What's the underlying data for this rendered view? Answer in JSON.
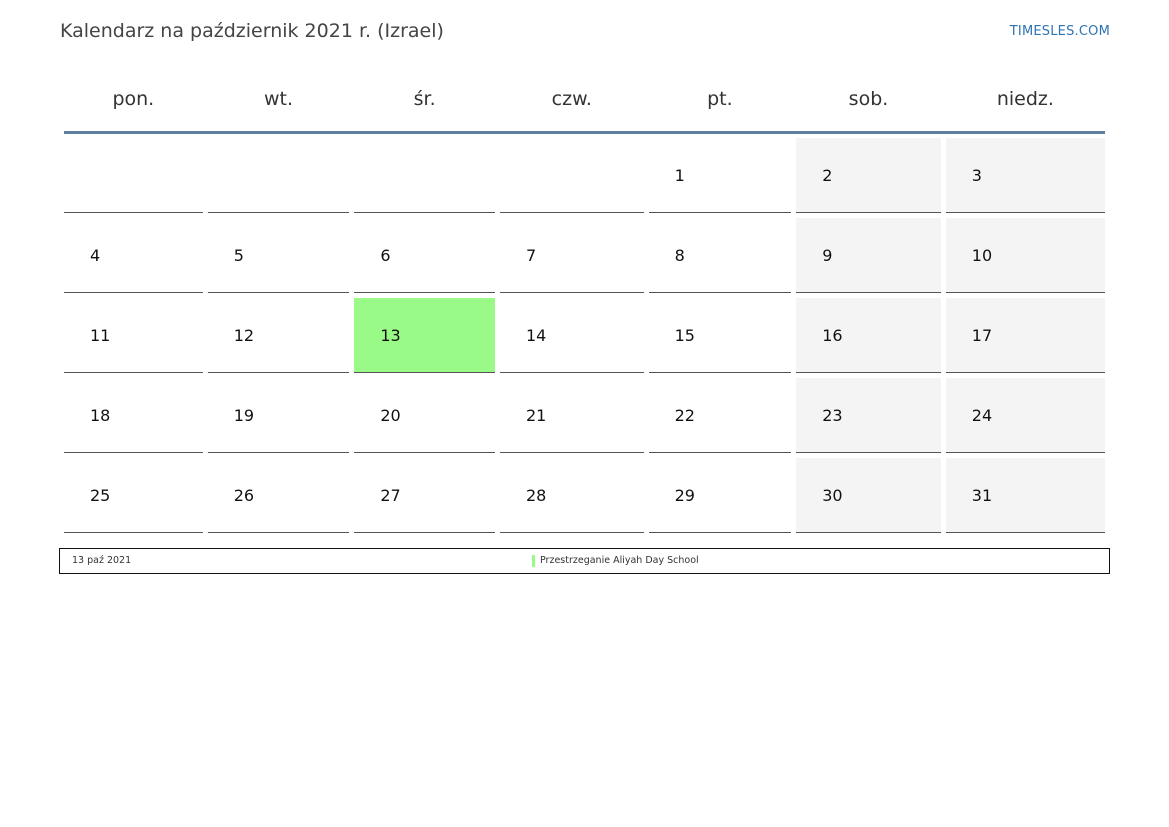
{
  "header": {
    "title": "Kalendarz na październik 2021 r. (Izrael)",
    "brand": "TIMESLES.COM"
  },
  "colors": {
    "header_rule": "#5f7f9f",
    "weekend_bg": "#f4f4f4",
    "highlight_bg": "#99fa87",
    "brand": "#2f73b3"
  },
  "calendar": {
    "weekdays": [
      "pon.",
      "wt.",
      "śr.",
      "czw.",
      "pt.",
      "sob.",
      "niedz."
    ],
    "weeks": [
      [
        "",
        "",
        "",
        "",
        "1",
        "2",
        "3"
      ],
      [
        "4",
        "5",
        "6",
        "7",
        "8",
        "9",
        "10"
      ],
      [
        "11",
        "12",
        "13",
        "14",
        "15",
        "16",
        "17"
      ],
      [
        "18",
        "19",
        "20",
        "21",
        "22",
        "23",
        "24"
      ],
      [
        "25",
        "26",
        "27",
        "28",
        "29",
        "30",
        "31"
      ]
    ],
    "highlighted_day": "13"
  },
  "legend": {
    "date": "13 paź 2021",
    "event": "Przestrzeganie Aliyah Day School"
  }
}
